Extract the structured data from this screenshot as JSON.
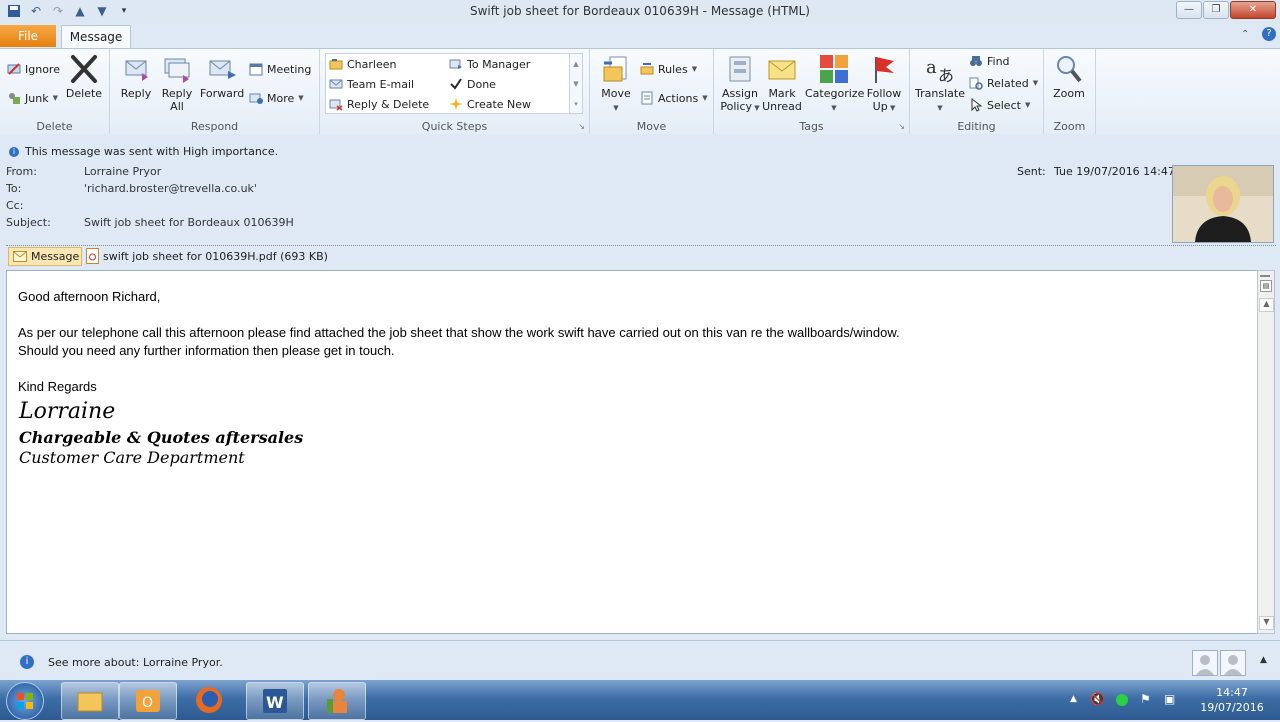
{
  "window": {
    "title": "Swift job sheet for Bordeaux 010639H  -  Message (HTML)"
  },
  "tabs": {
    "file": "File",
    "message": "Message"
  },
  "ribbon": {
    "delete_group": {
      "label": "Delete",
      "ignore": "Ignore",
      "junk": "Junk",
      "delete": "Delete"
    },
    "respond_group": {
      "label": "Respond",
      "reply": "Reply",
      "reply_all_1": "Reply",
      "reply_all_2": "All",
      "forward": "Forward",
      "meeting": "Meeting",
      "more": "More"
    },
    "quicksteps_group": {
      "label": "Quick Steps",
      "items": [
        "Charleen",
        "To Manager",
        "Team E-mail",
        "Done",
        "Reply & Delete",
        "Create New"
      ]
    },
    "move_group": {
      "label": "Move",
      "move": "Move",
      "rules": "Rules",
      "actions": "Actions"
    },
    "tags_group": {
      "label": "Tags",
      "assign_1": "Assign",
      "assign_2": "Policy",
      "mark_1": "Mark",
      "mark_2": "Unread",
      "categorize": "Categorize",
      "follow_1": "Follow",
      "follow_2": "Up"
    },
    "editing_group": {
      "label": "Editing",
      "translate": "Translate",
      "find": "Find",
      "related": "Related",
      "select": "Select"
    },
    "zoom_group": {
      "label": "Zoom",
      "zoom": "Zoom"
    }
  },
  "message": {
    "importance": "This message was sent with High importance.",
    "from_label": "From:",
    "from": "Lorraine Pryor",
    "to_label": "To:",
    "to": "'richard.broster@trevella.co.uk'",
    "cc_label": "Cc:",
    "cc": "",
    "subject_label": "Subject:",
    "subject": "Swift job sheet for Bordeaux 010639H",
    "sent_label": "Sent:",
    "sent": "Tue 19/07/2016 14:47",
    "message_tab": "Message",
    "attachment": "swift job sheet for 010639H.pdf (693 KB)",
    "body": {
      "greeting": "Good afternoon Richard,",
      "line1": "As per our telephone call this afternoon please find attached the job sheet that show the work swift have carried out on this van re the wallboards/window.",
      "line2": "Should you need any further information then please get in touch.",
      "regards": "Kind Regards",
      "sig_name": "Lorraine",
      "sig_title": "Chargeable & Quotes aftersales",
      "sig_dept": "Customer Care Department"
    }
  },
  "people_pane": {
    "text": "See more about: Lorraine Pryor."
  },
  "taskbar": {
    "time": "14:47",
    "date": "19/07/2016"
  }
}
